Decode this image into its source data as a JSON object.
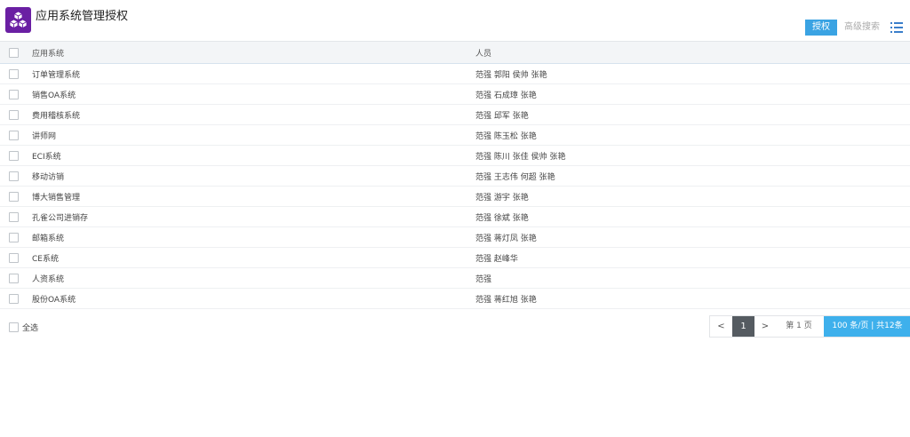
{
  "header": {
    "title": "应用系统管理授权",
    "authorize_button": "授权",
    "advanced_search_button": "高级搜索"
  },
  "table": {
    "columns": {
      "system": "应用系统",
      "people": "人员"
    },
    "rows": [
      {
        "system": "订单管理系统",
        "people": "范强 郭阳 侯帅 张艳"
      },
      {
        "system": "销售OA系统",
        "people": "范强 石成璋 张艳"
      },
      {
        "system": "费用稽核系统",
        "people": "范强 邱军 张艳"
      },
      {
        "system": "讲师网",
        "people": "范强 陈玉松 张艳"
      },
      {
        "system": "ECI系统",
        "people": "范强 陈川 张佳 侯帅 张艳"
      },
      {
        "system": "移动访销",
        "people": "范强 王志伟 何超 张艳"
      },
      {
        "system": "博大销售管理",
        "people": "范强 游宇 张艳"
      },
      {
        "system": "孔雀公司进销存",
        "people": "范强 徐斌 张艳"
      },
      {
        "system": "邮箱系统",
        "people": "范强 蒋灯凤 张艳"
      },
      {
        "system": "CE系统",
        "people": "范强 赵峰华"
      },
      {
        "system": "人资系统",
        "people": "范强"
      },
      {
        "system": "股份OA系统",
        "people": "范强 蒋红旭 张艳"
      }
    ]
  },
  "footer": {
    "select_all_label": "全选",
    "pager": {
      "prev": "<",
      "current_page": "1",
      "next": ">",
      "page_info": "第  1  页",
      "page_size_info": "100 条/页 | 共12条"
    }
  },
  "colors": {
    "logo_bg": "#6a1fa3",
    "primary": "#3aa3e3",
    "pager_active": "#555b61",
    "pager_size": "#3eb0ec"
  },
  "icons": {
    "logo": "cubes-icon",
    "list_view": "list-icon"
  }
}
